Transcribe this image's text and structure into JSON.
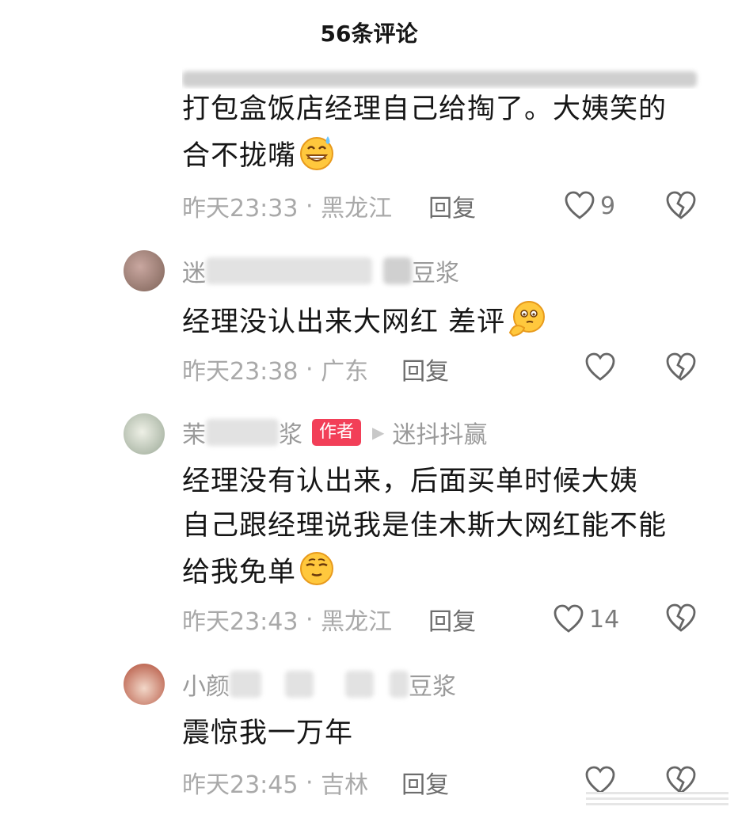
{
  "header": {
    "title": "56条评论"
  },
  "comments": [
    {
      "text_lines": [
        "打包盒饭店经理自己给掏了。大姨笑的",
        "合不拢嘴"
      ],
      "emoji": "grinning-sweat-emoji",
      "time": "昨天23:33",
      "location": "黑龙江",
      "reply": "回复",
      "likes": "9"
    },
    {
      "user_prefix": "迷",
      "user_suffix": "豆浆",
      "text": "经理没认出来大网红 差评",
      "emoji": "thinking-emoji",
      "time": "昨天23:38",
      "location": "广东",
      "reply": "回复",
      "likes": ""
    },
    {
      "user_prefix": "茉",
      "user_suffix": "浆",
      "badge": "作者",
      "reply_to": "迷抖抖赢",
      "text_lines": [
        "经理没有认出来，后面买单时候大姨",
        "自己跟经理说我是佳木斯大网红能不能",
        "给我免单"
      ],
      "emoji": "smug-emoji",
      "time": "昨天23:43",
      "location": "黑龙江",
      "reply": "回复",
      "likes": "14"
    },
    {
      "user_prefix": "小颜",
      "user_suffix": "豆浆",
      "text": "震惊我一万年",
      "time": "昨天23:45",
      "location": "吉林",
      "reply": "回复",
      "likes": ""
    }
  ],
  "colors": {
    "badge": "#f23f58",
    "meta_text": "#a9a9a9",
    "reply_text": "#6d6d6d"
  }
}
